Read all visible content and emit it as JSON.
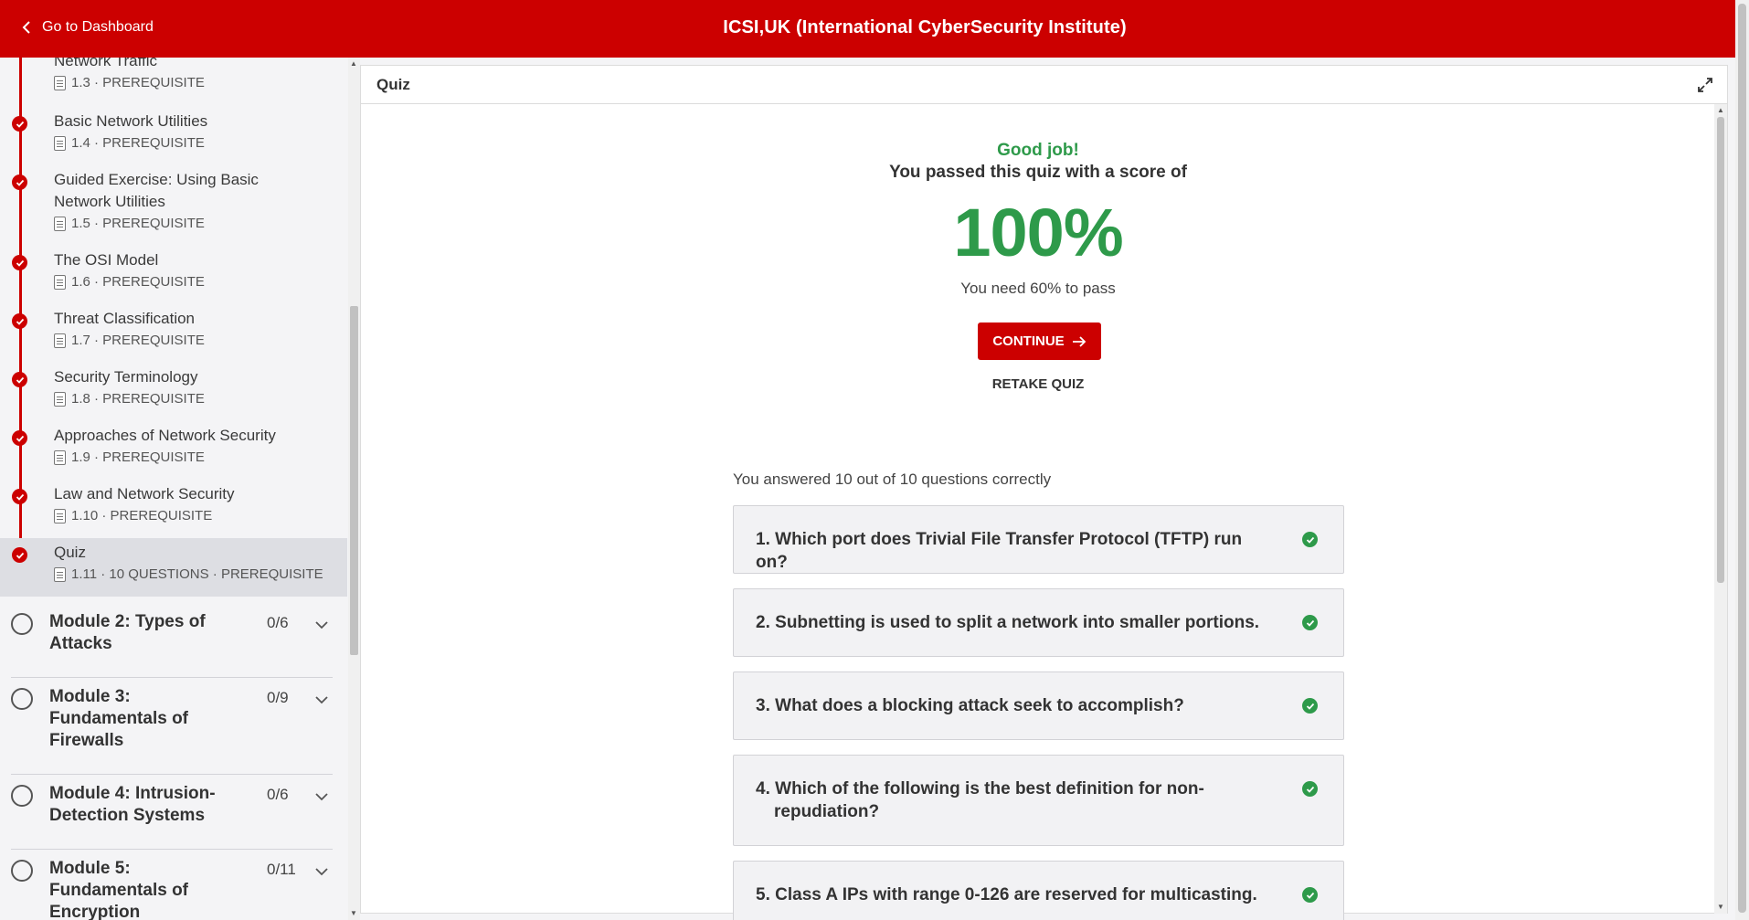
{
  "topbar": {
    "back_label": "Go to Dashboard",
    "title": "ICSI,UK (International CyberSecurity Institute)",
    "color": "#cc0000"
  },
  "sidebar": {
    "lessons": [
      {
        "title": "Network Traffic",
        "meta": "1.3 · PREREQUISITE",
        "icon": "document-icon",
        "completed": true
      },
      {
        "title": "Basic Network Utilities",
        "meta": "1.4 · PREREQUISITE",
        "icon": "document-icon",
        "completed": true
      },
      {
        "title": "Guided Exercise: Using Basic Network Utilities",
        "meta": "1.5 · PREREQUISITE",
        "icon": "document-icon",
        "completed": true
      },
      {
        "title": "The OSI Model",
        "meta": "1.6 · PREREQUISITE",
        "icon": "document-icon",
        "completed": true
      },
      {
        "title": "Threat Classification",
        "meta": "1.7 · PREREQUISITE",
        "icon": "document-icon",
        "completed": true
      },
      {
        "title": "Security Terminology",
        "meta": "1.8 · PREREQUISITE",
        "icon": "document-icon",
        "completed": true
      },
      {
        "title": "Approaches of Network Security",
        "meta": "1.9 · PREREQUISITE",
        "icon": "document-icon",
        "completed": true
      },
      {
        "title": "Law and Network Security",
        "meta": "1.10 · PREREQUISITE",
        "icon": "document-icon",
        "completed": true
      },
      {
        "title": "Quiz",
        "meta": "1.11 · 10 QUESTIONS · PREREQUISITE",
        "icon": "quiz-icon",
        "completed": true,
        "active": true
      }
    ],
    "modules": [
      {
        "title": "Module 2: Types of Attacks",
        "count": "0/6"
      },
      {
        "title": "Module 3: Fundamentals of Firewalls",
        "count": "0/9"
      },
      {
        "title": "Module 4: Intrusion-Detection Systems",
        "count": "0/6"
      },
      {
        "title": "Module 5: Fundamentals of Encryption",
        "count": "0/11"
      }
    ]
  },
  "main": {
    "header_label": "Quiz",
    "good_job": "Good job!",
    "passed_text": "You passed this quiz with a score of",
    "score": "100%",
    "need_text": "You need 60% to pass",
    "continue_label": "CONTINUE",
    "retake_label": "RETAKE QUIZ",
    "answered_text": "You answered 10 out of 10 questions correctly",
    "questions": [
      {
        "num": "1.",
        "text": "Which port does Trivial File Transfer Protocol (TFTP) run on?",
        "correct": true
      },
      {
        "num": "2.",
        "text": "Subnetting is used to split a network into smaller portions.",
        "correct": true
      },
      {
        "num": "3.",
        "text": "What does a blocking attack seek to accomplish?",
        "correct": true
      },
      {
        "num": "4.",
        "text": "Which of the following is the best definition for non-repudiation?",
        "correct": true
      },
      {
        "num": "5.",
        "text": "Class A IPs with range 0-126 are reserved for multicasting.",
        "correct": true
      }
    ],
    "success_color": "#2e9a4a"
  }
}
